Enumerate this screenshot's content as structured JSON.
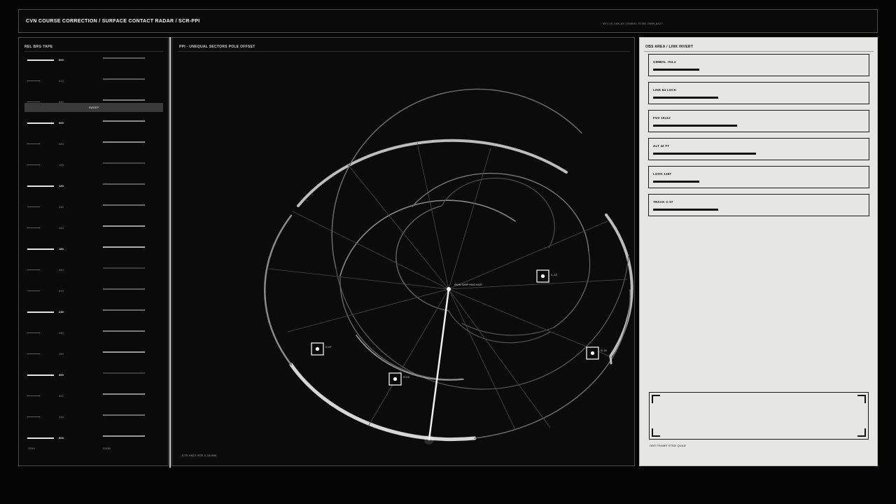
{
  "header": {
    "title": "CVN COURSE CORRECTION  /  SURFACE CONTACT RADAR  /  SCR-PPI",
    "status": "V01/16   LNK 84   GIMBAL STBD  OWN 8427"
  },
  "tape": {
    "label": "REL BRG TAPE",
    "rows": [
      {
        "num": "000",
        "major": true,
        "bar": "#5a5a5a"
      },
      {
        "num": "020",
        "major": false,
        "bar": "#5a5a5a"
      },
      {
        "num": "040",
        "major": false,
        "bar": "#7a7a7a"
      },
      {
        "num": "060",
        "major": true,
        "bar": "#8a8a8a"
      },
      {
        "num": "080",
        "major": false,
        "bar": "#8a8a8a"
      },
      {
        "num": "100",
        "major": false,
        "bar": "#444444"
      },
      {
        "num": "120",
        "major": true,
        "bar": "#5a5a5a"
      },
      {
        "num": "140",
        "major": false,
        "bar": "#6a6a6a"
      },
      {
        "num": "160",
        "major": false,
        "bar": "#9a9a9a"
      },
      {
        "num": "180",
        "major": true,
        "bar": "#b0b0b0"
      },
      {
        "num": "200",
        "major": false,
        "bar": "#3a3a3a"
      },
      {
        "num": "220",
        "major": false,
        "bar": "#5a5a5a"
      },
      {
        "num": "240",
        "major": true,
        "bar": "#6a6a6a"
      },
      {
        "num": "260",
        "major": false,
        "bar": "#7a7a7a"
      },
      {
        "num": "280",
        "major": false,
        "bar": "#9a9a9a"
      },
      {
        "num": "300",
        "major": true,
        "bar": "#3a3a3a"
      },
      {
        "num": "320",
        "major": false,
        "bar": "#8a8a8a"
      },
      {
        "num": "340",
        "major": false,
        "bar": "#6a6a6a"
      },
      {
        "num": "000",
        "major": true,
        "bar": "#9a9a9a"
      }
    ],
    "sweep_label": "SWEEP",
    "foot_left": "STBY",
    "foot_right": "STBD"
  },
  "ppi": {
    "label": "PPI  -  UNEQUAL SECTORS  POLE OFFSET",
    "own_ship": "OWN SHIP  HDG 8427",
    "readout": "CTS  8427   XTE  0.18 NM",
    "contacts": [
      {
        "id": "C-12"
      },
      {
        "id": "C-07"
      },
      {
        "id": "C-03"
      },
      {
        "id": "C-15"
      }
    ]
  },
  "obs": {
    "label": "OBS AREA  /  LINK INVERT",
    "cards": [
      {
        "label": "GIMBAL +04.2",
        "fill": 0.22
      },
      {
        "label": "LINK 84 LOCK",
        "fill": 0.31
      },
      {
        "label": "FOV 16x12",
        "fill": 0.4
      },
      {
        "label": "ALT 42 FT",
        "fill": 0.49
      },
      {
        "label": "LOOK 128T",
        "fill": 0.22
      },
      {
        "label": "TRACK C-07",
        "fill": 0.31
      }
    ],
    "frame_caption": "OBS FRAME  STBD QUAD"
  },
  "colors": {
    "panel_dark": "#0a0a0a",
    "panel_light": "#e6e7e4",
    "accent": "#f2f2f2"
  }
}
